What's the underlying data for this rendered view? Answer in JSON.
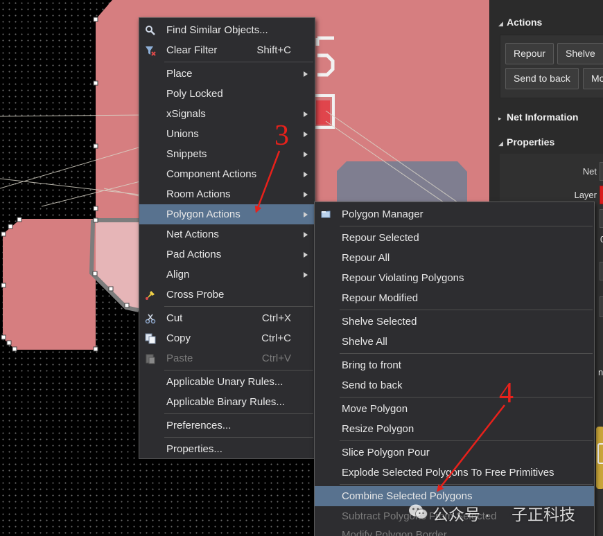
{
  "panel": {
    "actions_header": "Actions",
    "buttons": [
      "Repour",
      "Shelve",
      "Send to back",
      "Mo"
    ],
    "net_info_header": "Net Information",
    "properties_header": "Properties",
    "net_label": "Net",
    "layer_label": "Layer",
    "layer_color": "#d81c1c",
    "partial_char_1": "0",
    "partial_char_2": "nd"
  },
  "canvas": {
    "polygon_color": "#d67e80",
    "selected_polygon_color": "#e6b5b7",
    "gray_polygon_color": "#7f7e90",
    "silk_text": "5"
  },
  "context_menu": {
    "items": [
      {
        "label": "Find Similar Objects...",
        "icon": "magnifier-icon"
      },
      {
        "label": "Clear Filter",
        "shortcut": "Shift+C",
        "icon": "clear-filter-icon"
      },
      {
        "label": "Place",
        "submenu": true
      },
      {
        "label": "Poly Locked"
      },
      {
        "label": "xSignals",
        "submenu": true
      },
      {
        "label": "Unions",
        "submenu": true
      },
      {
        "label": "Snippets",
        "submenu": true
      },
      {
        "label": "Component Actions",
        "submenu": true
      },
      {
        "label": "Room Actions",
        "submenu": true
      },
      {
        "label": "Polygon Actions",
        "submenu": true,
        "highlighted": true
      },
      {
        "label": "Net Actions",
        "submenu": true
      },
      {
        "label": "Pad Actions",
        "submenu": true
      },
      {
        "label": "Align",
        "submenu": true
      },
      {
        "label": "Cross Probe",
        "icon": "cross-probe-icon"
      },
      {
        "label": "Cut",
        "shortcut": "Ctrl+X",
        "icon": "scissors-icon"
      },
      {
        "label": "Copy",
        "shortcut": "Ctrl+C",
        "icon": "copy-icon"
      },
      {
        "label": "Paste",
        "shortcut": "Ctrl+V",
        "icon": "paste-icon",
        "disabled": true
      },
      {
        "label": "Applicable Unary Rules..."
      },
      {
        "label": "Applicable Binary Rules..."
      },
      {
        "label": "Preferences..."
      },
      {
        "label": "Properties..."
      }
    ]
  },
  "polygon_submenu": {
    "items": [
      {
        "label": "Polygon Manager",
        "icon": "polygon-manager-icon"
      },
      {
        "label": "Repour Selected"
      },
      {
        "label": "Repour All"
      },
      {
        "label": "Repour Violating Polygons"
      },
      {
        "label": "Repour Modified"
      },
      {
        "label": "Shelve Selected"
      },
      {
        "label": "Shelve All"
      },
      {
        "label": "Bring to front"
      },
      {
        "label": "Send to back"
      },
      {
        "label": "Move Polygon"
      },
      {
        "label": "Resize Polygon"
      },
      {
        "label": "Slice Polygon Pour"
      },
      {
        "label": "Explode Selected Polygons To Free Primitives"
      },
      {
        "label": "Combine Selected Polygons",
        "highlighted": true
      },
      {
        "label": "Subtract Polygons From Selected",
        "disabled": true
      },
      {
        "label": "Modify Polygon Border",
        "disabled": true
      }
    ]
  },
  "annotations": {
    "step3": "3",
    "step4": "4",
    "color": "#e8211b"
  },
  "watermark": {
    "text1": "公众号 ·",
    "text2": "子正科技"
  }
}
